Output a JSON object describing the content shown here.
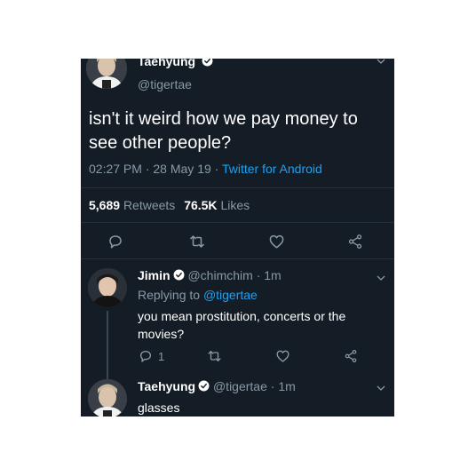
{
  "main_tweet": {
    "display_name": "Taehyung",
    "handle": "@tigertae",
    "text": "isn't it weird how we pay money to see other people?",
    "time": "02:27 PM",
    "date": "28 May 19",
    "source": "Twitter for Android",
    "retweets_count": "5,689",
    "retweets_label": "Retweets",
    "likes_count": "76.5K",
    "likes_label": "Likes",
    "sep": "·"
  },
  "reply_1": {
    "display_name": "Jimin",
    "handle": "@chimchim",
    "sep": "·",
    "age": "1m",
    "replying_prefix": "Replying to",
    "replying_to": "@tigertae",
    "text": "you mean prostitution, concerts or the movies?",
    "reply_count": "1"
  },
  "reply_2": {
    "display_name": "Taehyung",
    "handle": "@tigertae",
    "sep": "·",
    "age": "1m",
    "text": "glasses"
  },
  "colors": {
    "background": "#141d26",
    "text": "#ffffff",
    "muted": "#8899a6",
    "link": "#1da1f2",
    "verified": "#ffffff"
  },
  "icons": [
    "reply-icon",
    "retweet-icon",
    "like-icon",
    "share-icon",
    "verified-badge-icon",
    "chevron-down-icon"
  ]
}
